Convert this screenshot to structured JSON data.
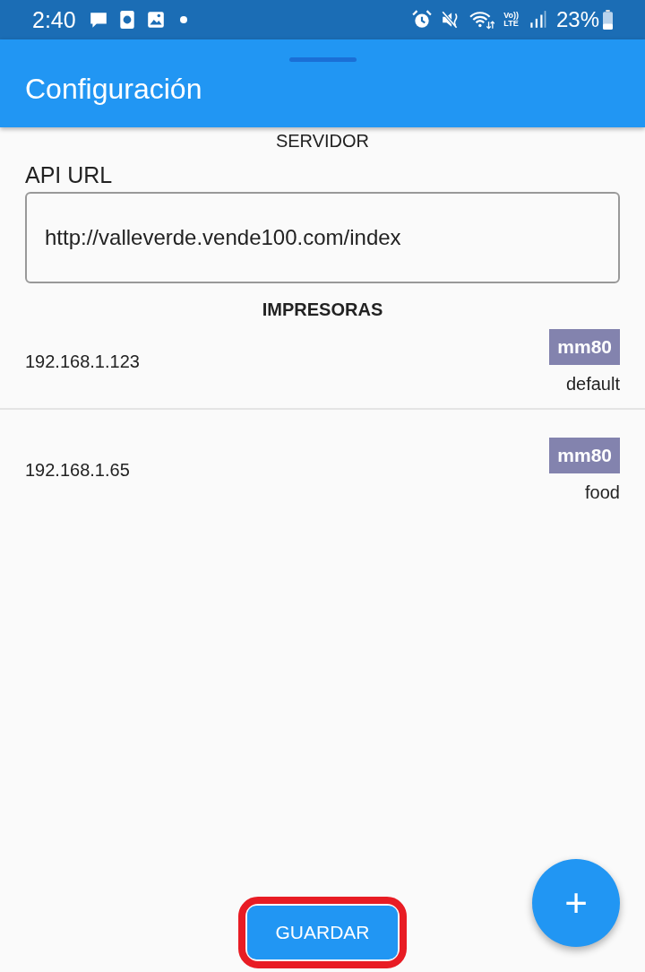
{
  "status_bar": {
    "time": "2:40",
    "network_top": "Vo))",
    "network_bottom": "LTE",
    "battery": "23%"
  },
  "app_bar": {
    "title": "Configuración"
  },
  "server_section": {
    "heading": "SERVIDOR",
    "field_label": "API URL",
    "value": "http://valleverde.vende100.com/index"
  },
  "printers_section": {
    "heading": "IMPRESORAS",
    "printers": [
      {
        "address": "192.168.1.123",
        "model": "mm80",
        "name": "default"
      },
      {
        "address": "192.168.1.65",
        "model": "mm80",
        "name": "food"
      }
    ]
  },
  "save_button": {
    "label": "GUARDAR",
    "highlighted": true
  },
  "fab": {
    "label": "+"
  }
}
